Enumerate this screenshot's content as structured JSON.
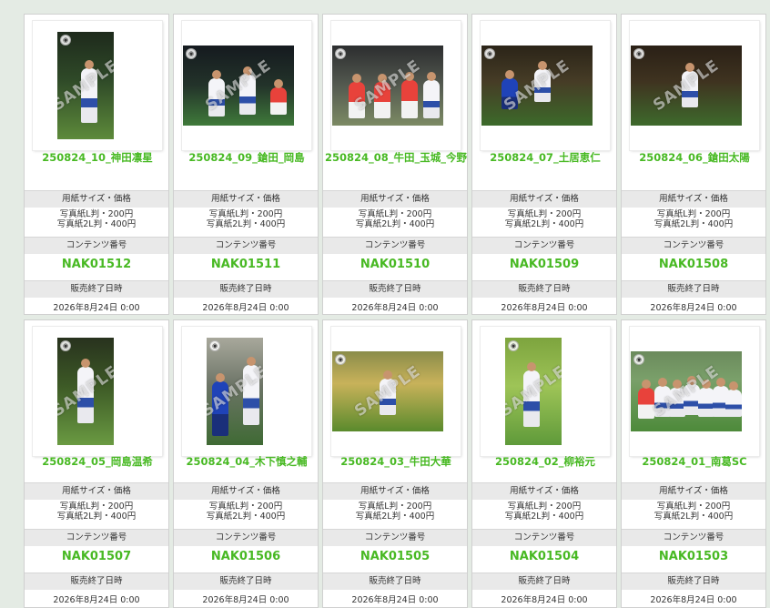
{
  "labels": {
    "size_price": "用紙サイズ・価格",
    "price_l": "写真紙L判・200円",
    "price_2l": "写真紙2L判・400円",
    "content_no": "コンテンツ番号",
    "end_label": "販売終了日時",
    "watermark": "SAMPLE"
  },
  "colors": {
    "accent": "#48b923",
    "band": "#e9e9e9",
    "page_bg": "#e4ebe4"
  },
  "items": [
    {
      "title": "250824_10_神田凛星",
      "code": "NAK01512",
      "end": "2026年8月24日 0:00"
    },
    {
      "title": "250824_09_鎗田_岡島",
      "code": "NAK01511",
      "end": "2026年8月24日 0:00"
    },
    {
      "title": "250824_08_牛田_玉城_今野",
      "code": "NAK01510",
      "end": "2026年8月24日 0:00"
    },
    {
      "title": "250824_07_土居恵仁",
      "code": "NAK01509",
      "end": "2026年8月24日 0:00"
    },
    {
      "title": "250824_06_鎗田太陽",
      "code": "NAK01508",
      "end": "2026年8月24日 0:00"
    },
    {
      "title": "250824_05_岡島温希",
      "code": "NAK01507",
      "end": "2026年8月24日 0:00"
    },
    {
      "title": "250824_04_木下慎之輔",
      "code": "NAK01506",
      "end": "2026年8月24日 0:00"
    },
    {
      "title": "250824_03_牛田大華",
      "code": "NAK01505",
      "end": "2026年8月24日 0:00"
    },
    {
      "title": "250824_02_柳裕元",
      "code": "NAK01504",
      "end": "2026年8月24日 0:00"
    },
    {
      "title": "250824_01_南葛SC",
      "code": "NAK01503",
      "end": "2026年8月24日 0:00"
    }
  ]
}
